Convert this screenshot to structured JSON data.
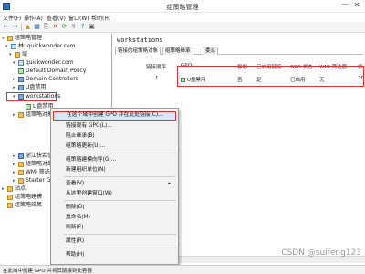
{
  "window": {
    "title": "组策略管理",
    "minimize": "—",
    "close": "✕"
  },
  "menubar": [
    "文件(F)",
    "操作(A)",
    "查看(V)",
    "窗口(W)",
    "帮助(H)"
  ],
  "toolbar": {
    "back": "←",
    "forward": "→",
    "up": "▲",
    "tree": "▦",
    "copy": "⎘",
    "delete": "✕",
    "refresh": "⟳",
    "export": "⇪",
    "help": "?",
    "console": "▣"
  },
  "tree": {
    "root": "组策略管理",
    "forest": "林: quickwonder.com",
    "domains_folder": "域",
    "domain": "quickwonder.com",
    "items": [
      "Default Domain Policy",
      "Domain Controllers",
      "U盘禁用",
      "workstations",
      "U盘禁用",
      "组策略对象",
      "浙江快若信息",
      "组策略对象",
      "WMI 筛选器",
      "Starter GPO",
      "站点",
      "组策略建模",
      "组策略结果"
    ]
  },
  "right_pane": {
    "title": "workstations",
    "tabs": [
      "链接的组策略对象",
      "组策略继承",
      "委派"
    ],
    "columns": [
      "链接顺序",
      "GPO",
      "强制",
      "已启用链接",
      "GPO 状态",
      "WMI 筛选器",
      "修"
    ],
    "rows": [
      {
        "order": "1",
        "gpo": "U盘禁用",
        "enforced": "否",
        "enabled": "是",
        "status": "已启用",
        "wmi": "无",
        "modified": "20"
      }
    ]
  },
  "context_menu": {
    "items": [
      "在这个域中创建 GPO 并在此处链接(C)...",
      "链接现有 GPO(L)...",
      "阻止继承(B)",
      "组策略更新(U)...",
      "组策略建模向导(G)...",
      "新建组织单位(N)",
      "查看(V)",
      "从这里创建窗口(W)",
      "删除(D)",
      "重命名(M)",
      "刷新(F)",
      "属性(R)",
      "帮助(H)"
    ],
    "submenu_arrow": "▸"
  },
  "statusbar": {
    "text": "在此域中创建 GPO 并将其链接到此容器"
  },
  "watermark": "CSDN @suifeng123",
  "colors": {
    "highlight_border": "#e03030",
    "menu_hover": "#d8e6f6",
    "folder": "#e9c35b"
  }
}
